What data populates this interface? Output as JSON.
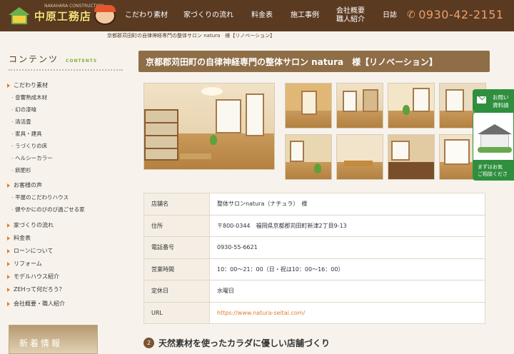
{
  "header": {
    "logo_text": "中原工務店",
    "logo_sub": "NAKAHARA CONSTRUCTION",
    "nav": [
      {
        "label": "こだわり素材"
      },
      {
        "label": "家づくりの流れ"
      },
      {
        "label": "料金表"
      },
      {
        "label": "施工事例"
      },
      {
        "label": "会社概要\n職人紹介"
      },
      {
        "label": "日誌"
      }
    ],
    "phone": "0930-42-2151"
  },
  "breadcrumb": "京都郡苅田町の自律神経専門の整体サロン natura　様【リノベーション】",
  "sidebar": {
    "title": "コンテンツ",
    "title_sub": "CONTENTS",
    "menu": [
      {
        "label": "こだわり素材",
        "level": 1
      },
      {
        "label": "音響熟成木材",
        "level": 2
      },
      {
        "label": "幻の漆喰",
        "level": 2
      },
      {
        "label": "清活畳",
        "level": 2
      },
      {
        "label": "家具・建具",
        "level": 2
      },
      {
        "label": "うづくりの床",
        "level": 2
      },
      {
        "label": "ヘルシーカラー",
        "level": 2
      },
      {
        "label": "飫肥杉",
        "level": 2
      },
      {
        "label": "お客様の声",
        "level": 1
      },
      {
        "label": "平屋のこだわりハウス",
        "level": 2
      },
      {
        "label": "健やかにのびのび過ごせる家",
        "level": 2
      },
      {
        "label": "家づくりの流れ",
        "level": 1
      },
      {
        "label": "料金表",
        "level": 1
      },
      {
        "label": "ローンについて",
        "level": 1
      },
      {
        "label": "リフォーム",
        "level": 1
      },
      {
        "label": "モデルハウス紹介",
        "level": 1
      },
      {
        "label": "ZEHって何だろう？",
        "level": 1
      },
      {
        "label": "会社概要・職人紹介",
        "level": 1
      }
    ],
    "news_label": "新着情報"
  },
  "main": {
    "title": "京都郡苅田町の自律神経専門の整体サロン natura　様【リノベーション】",
    "info": [
      {
        "key": "店舗名",
        "value": "整体サロンnatura（ナチュラ）　様"
      },
      {
        "key": "住所",
        "value": "〒800-0344　福岡県京都郡苅田町新津2丁目9-13"
      },
      {
        "key": "電話番号",
        "value": "0930-55-6621"
      },
      {
        "key": "営業時間",
        "value": "10：00〜21：00（日・祝は10：00〜16：00）"
      },
      {
        "key": "定休日",
        "value": "水曜日"
      },
      {
        "key": "URL",
        "value": "https://www.natura-seitai.com/"
      }
    ],
    "section_number": "2",
    "section_heading": "天然素材を使ったカラダに優しい店舗づくり"
  },
  "float": {
    "contact_line1": "お問い",
    "contact_line2": "資料請",
    "cta_line1": "まずはお気",
    "cta_line2": "ご相談くださ"
  }
}
